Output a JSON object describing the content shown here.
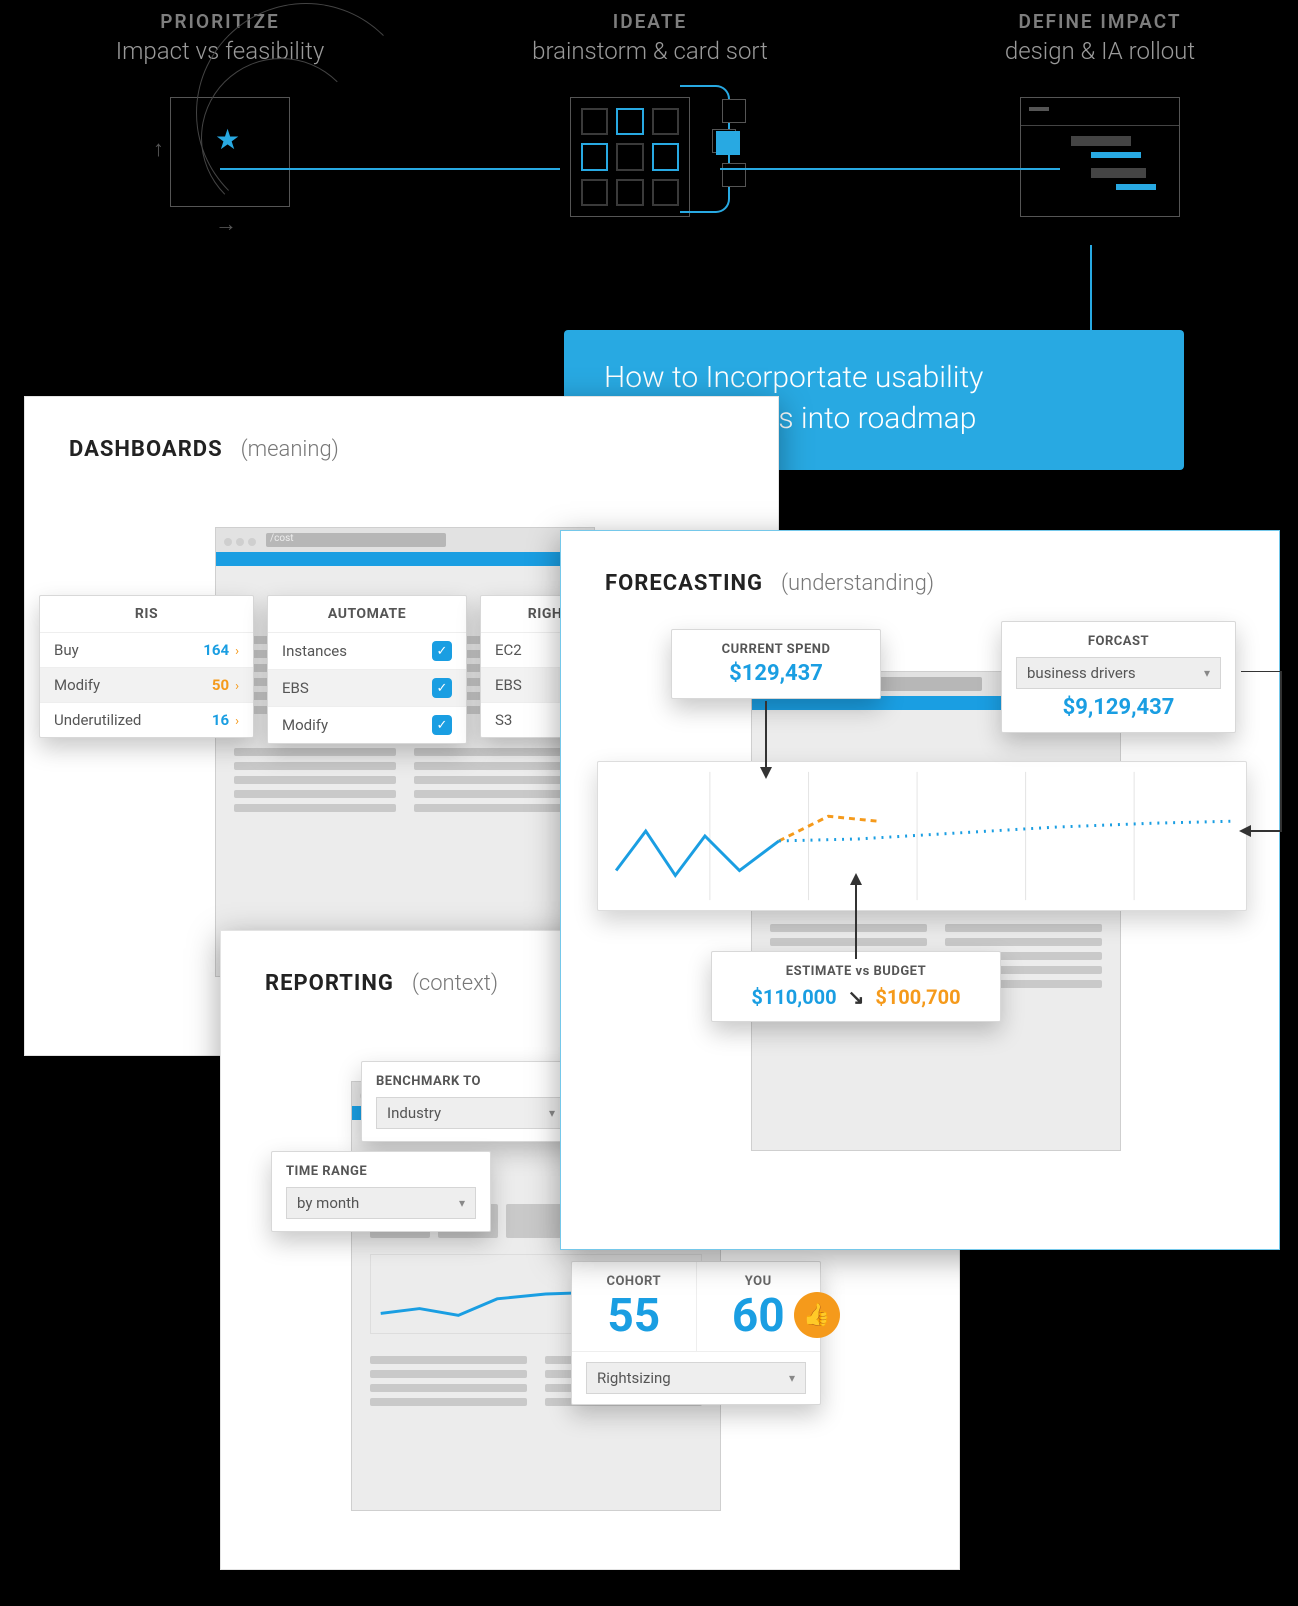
{
  "process": {
    "step1": {
      "title": "PRIORITIZE",
      "sub": "Impact vs feasibility"
    },
    "step2": {
      "title": "IDEATE",
      "sub": "brainstorm & card sort"
    },
    "step3": {
      "title": "DEFINE IMPACT",
      "sub": "design & IA rollout"
    }
  },
  "callout": {
    "text": "How to Incorportate usability improvements into roadmap"
  },
  "dashboards": {
    "title": "DASHBOARDS",
    "sub": "(meaning)",
    "url": "/cost",
    "cards": {
      "ris": {
        "title": "RIs",
        "rows": [
          {
            "label": "Buy",
            "value": "164",
            "style": "blue"
          },
          {
            "label": "Modify",
            "value": "50",
            "style": "orange"
          },
          {
            "label": "Underutilized",
            "value": "16",
            "style": "blue"
          }
        ]
      },
      "automate": {
        "title": "AUTOMATE",
        "rows": [
          {
            "label": "Instances",
            "checked": true
          },
          {
            "label": "EBS",
            "checked": true
          },
          {
            "label": "Modify",
            "checked": true
          }
        ]
      },
      "rightsize": {
        "title": "RIGHTSIZE",
        "rows": [
          {
            "label": "EC2"
          },
          {
            "label": "EBS"
          },
          {
            "label": "S3"
          }
        ]
      }
    }
  },
  "forecasting": {
    "title": "FORECASTING",
    "sub": "(understanding)",
    "current_spend": {
      "label": "CURRENT SPEND",
      "value": "$129,437"
    },
    "forecast": {
      "label": "FORCAST",
      "driver": "business drivers",
      "value": "$9,129,437"
    },
    "estimate": {
      "label": "ESTIMATE vs BUDGET",
      "left": "$110,000",
      "right": "$100,700"
    }
  },
  "reporting": {
    "title": "REPORTING",
    "sub": "(context)",
    "benchmark": {
      "label": "BENCHMARK TO",
      "value": "Industry"
    },
    "timerange": {
      "label": "TIME RANGE",
      "value": "by month"
    },
    "cohort": {
      "cohort_label": "COHORT",
      "you_label": "YOU",
      "cohort_value": "55",
      "you_value": "60",
      "select": "Rightsizing"
    }
  }
}
